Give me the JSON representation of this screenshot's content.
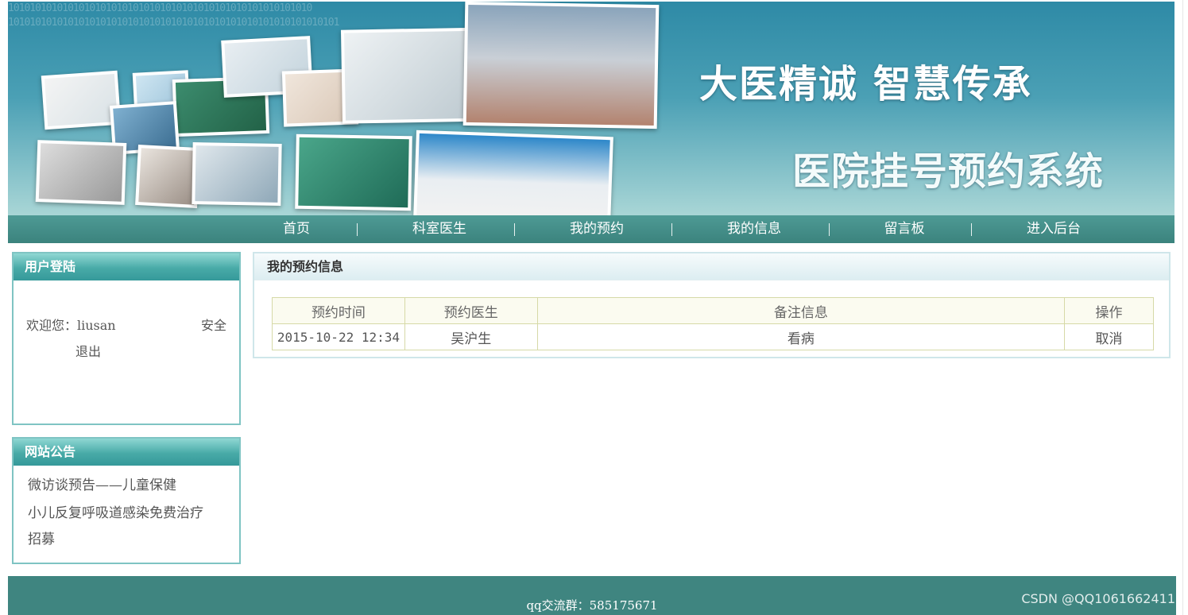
{
  "banner": {
    "slogan_line1": "大医精诚  智慧传承",
    "slogan_line2": "医院挂号预约系统",
    "binary_text": "10101010101010101010101010101010101010101010101010101010\n1010101010101010101010101010101010101010101010101010101010101"
  },
  "nav": {
    "items": [
      "首页",
      "科室医生",
      "我的预约",
      "我的信息",
      "留言板",
      "进入后台"
    ]
  },
  "login": {
    "title": "用户登陆",
    "welcome": "欢迎您：liusan",
    "logout_part1": "安全",
    "logout_part2": "退出"
  },
  "notice": {
    "title": "网站公告",
    "items": [
      "微访谈预告——儿童保健",
      "小儿反复呼吸道感染免费治疗",
      "招募"
    ]
  },
  "appointments": {
    "title": "我的预约信息",
    "columns": [
      "预约时间",
      "预约医生",
      "备注信息",
      "操作"
    ],
    "rows": [
      {
        "time": "2015-10-22 12:34",
        "doctor": "吴沪生",
        "note": "看病",
        "action": "取消"
      }
    ]
  },
  "footer": {
    "qq_group": "qq交流群：585175671"
  },
  "watermark": "CSDN @QQ1061662411",
  "colors": {
    "nav_bg": "#3b837d",
    "panel_border": "#7fc4c3",
    "panel_header": "#48aaa7",
    "footer_bg": "#3f8580"
  }
}
